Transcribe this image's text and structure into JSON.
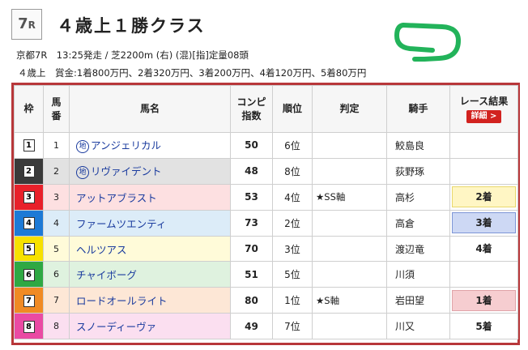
{
  "race": {
    "number": "7",
    "suffix": "R",
    "title": "４歳上１勝クラス",
    "info_line1": "京都7R　13:25発走 / 芝2200m (右) (混)[指]定量08頭",
    "info_line2": "４歳上　賞金:1着800万円、2着320万円、3着200万円、4着120万円、5着80万円"
  },
  "table": {
    "headers": {
      "waku": "枠",
      "umaban": "馬番",
      "name": "馬名",
      "compi": "コンピ指数",
      "rank": "順位",
      "judge": "判定",
      "jockey": "騎手",
      "result": "レース結果",
      "detail_button": "詳細 >"
    },
    "rows": [
      {
        "waku": "1",
        "ban": "1",
        "chi": "地",
        "name": "アンジェリカル",
        "points": "50",
        "rank": "6位",
        "judge": "",
        "jockey": "鮫島良",
        "result": "",
        "waku_bg": "#ffffff",
        "row_bg": "#ffffff",
        "res_bg": "",
        "res_border": ""
      },
      {
        "waku": "2",
        "ban": "2",
        "chi": "地",
        "name": "リヴァイデント",
        "points": "48",
        "rank": "8位",
        "judge": "",
        "jockey": "荻野琢",
        "result": "",
        "waku_bg": "#3a3a3a",
        "row_bg": "#e2e2e2",
        "res_bg": "",
        "res_border": ""
      },
      {
        "waku": "3",
        "ban": "3",
        "chi": "",
        "name": "アットアブラスト",
        "points": "53",
        "rank": "4位",
        "judge": "★SS軸",
        "jockey": "高杉",
        "result": "2着",
        "waku_bg": "#e8202a",
        "row_bg": "#fde0e1",
        "res_bg": "#fff6c4",
        "res_border": "#e9d86c"
      },
      {
        "waku": "4",
        "ban": "4",
        "chi": "",
        "name": "ファームツエンティ",
        "points": "73",
        "rank": "2位",
        "judge": "",
        "jockey": "高倉",
        "result": "3着",
        "waku_bg": "#1d7ad6",
        "row_bg": "#dcecf8",
        "res_bg": "#cdd8f4",
        "res_border": "#7d95d6"
      },
      {
        "waku": "5",
        "ban": "5",
        "chi": "",
        "name": "ヘルツアス",
        "points": "70",
        "rank": "3位",
        "judge": "",
        "jockey": "渡辺竜",
        "result": "4着",
        "waku_bg": "#f7e100",
        "row_bg": "#fffbd9",
        "res_bg": "",
        "res_border": ""
      },
      {
        "waku": "6",
        "ban": "6",
        "chi": "",
        "name": "チャイボーグ",
        "points": "51",
        "rank": "5位",
        "judge": "",
        "jockey": "川須",
        "result": "",
        "waku_bg": "#2fa843",
        "row_bg": "#dff2df",
        "res_bg": "",
        "res_border": ""
      },
      {
        "waku": "7",
        "ban": "7",
        "chi": "",
        "name": "ロードオールライト",
        "points": "80",
        "rank": "1位",
        "judge": "★S軸",
        "jockey": "岩田望",
        "result": "1着",
        "waku_bg": "#f08a24",
        "row_bg": "#fde7d6",
        "res_bg": "#f6cdd0",
        "res_border": "#e0a3a8"
      },
      {
        "waku": "8",
        "ban": "8",
        "chi": "",
        "name": "スノーディーヴァ",
        "points": "49",
        "rank": "7位",
        "judge": "",
        "jockey": "川又",
        "result": "5着",
        "waku_bg": "#ea4aa3",
        "row_bg": "#fbdff0",
        "res_bg": "",
        "res_border": ""
      }
    ]
  },
  "colors": {
    "accent_red": "#b8373a",
    "track_green": "#22b35a",
    "link_blue": "#1a3b9e"
  },
  "icons": {
    "track": "course-shape-icon"
  }
}
